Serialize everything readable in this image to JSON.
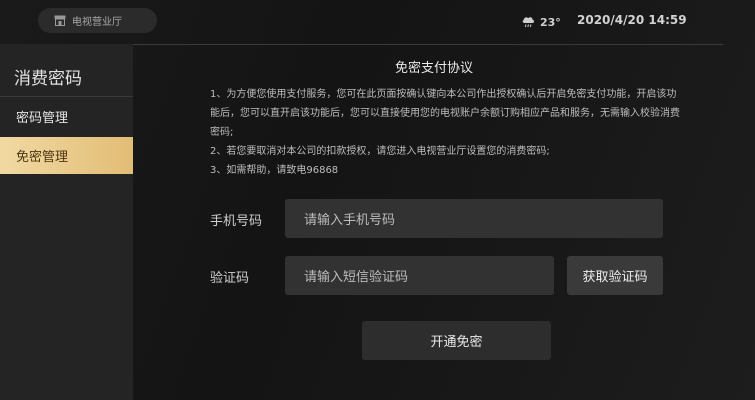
{
  "topbar": {
    "store_label": "电视营业厅",
    "store_icon": "store-icon",
    "weather_icon": "cloud-rain-icon",
    "temperature": "23°",
    "datetime": "2020/4/20 14:59"
  },
  "sidebar": {
    "title": "消费密码",
    "items": [
      {
        "label": "密码管理",
        "selected": false
      },
      {
        "label": "免密管理",
        "selected": true
      }
    ]
  },
  "agreement": {
    "title": "免密支付协议",
    "paragraphs": [
      "1、为方便您使用支付服务，您可在此页面按确认键向本公司作出授权确认后开启免密支付功能，开启该功能后，您可以直开启该功能后，您可以直接使用您的电视账户余额订购相应产品和服务，无需输入校验消费密码;",
      "2、若您要取消对本公司的扣款授权，请您进入电视营业厅设置您的消费密码;",
      "3、如需帮助，请致电96868"
    ]
  },
  "form": {
    "phone_label": "手机号码",
    "phone_placeholder": "请输入手机号码",
    "code_label": "验证码",
    "code_placeholder": "请输入短信验证码",
    "get_code_label": "获取验证码",
    "submit_label": "开通免密"
  },
  "colors": {
    "accent_gold": "#e9c98a",
    "background": "#141414",
    "sidebar": "#242424",
    "input": "#323232"
  }
}
